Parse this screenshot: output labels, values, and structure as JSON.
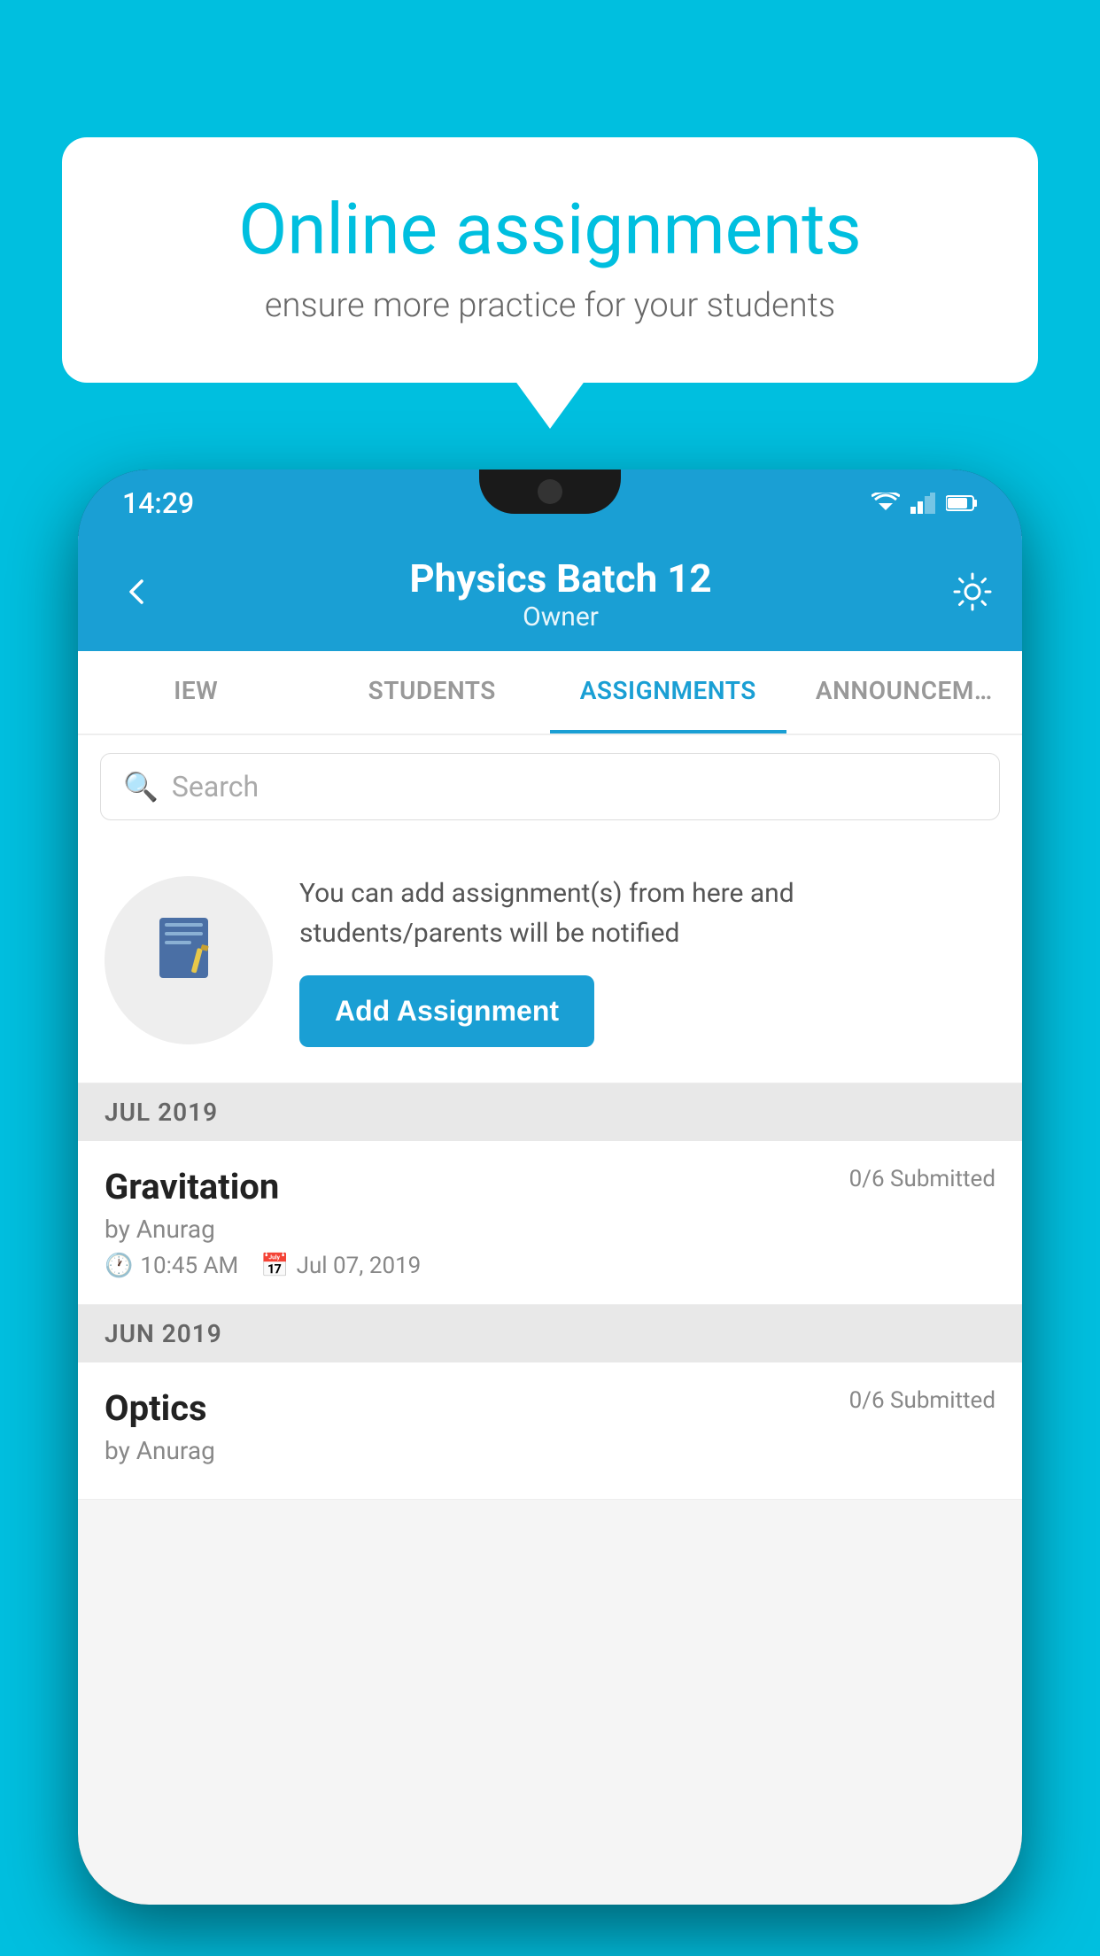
{
  "background_color": "#00BFDF",
  "bubble": {
    "title": "Online assignments",
    "subtitle": "ensure more practice for your students"
  },
  "phone": {
    "status_bar": {
      "time": "14:29"
    },
    "app_bar": {
      "title": "Physics Batch 12",
      "subtitle": "Owner",
      "back_label": "←"
    },
    "tabs": [
      {
        "label": "IEW",
        "active": false
      },
      {
        "label": "STUDENTS",
        "active": false
      },
      {
        "label": "ASSIGNMENTS",
        "active": true
      },
      {
        "label": "ANNOUNCEM…",
        "active": false
      }
    ],
    "search": {
      "placeholder": "Search"
    },
    "promo": {
      "description": "You can add assignment(s) from here and students/parents will be notified",
      "button_label": "Add Assignment"
    },
    "assignments": [
      {
        "section": "JUL 2019",
        "title": "Gravitation",
        "submitted": "0/6 Submitted",
        "author": "by Anurag",
        "time": "10:45 AM",
        "date": "Jul 07, 2019"
      },
      {
        "section": "JUN 2019",
        "title": "Optics",
        "submitted": "0/6 Submitted",
        "author": "by Anurag",
        "time": "",
        "date": ""
      }
    ]
  }
}
